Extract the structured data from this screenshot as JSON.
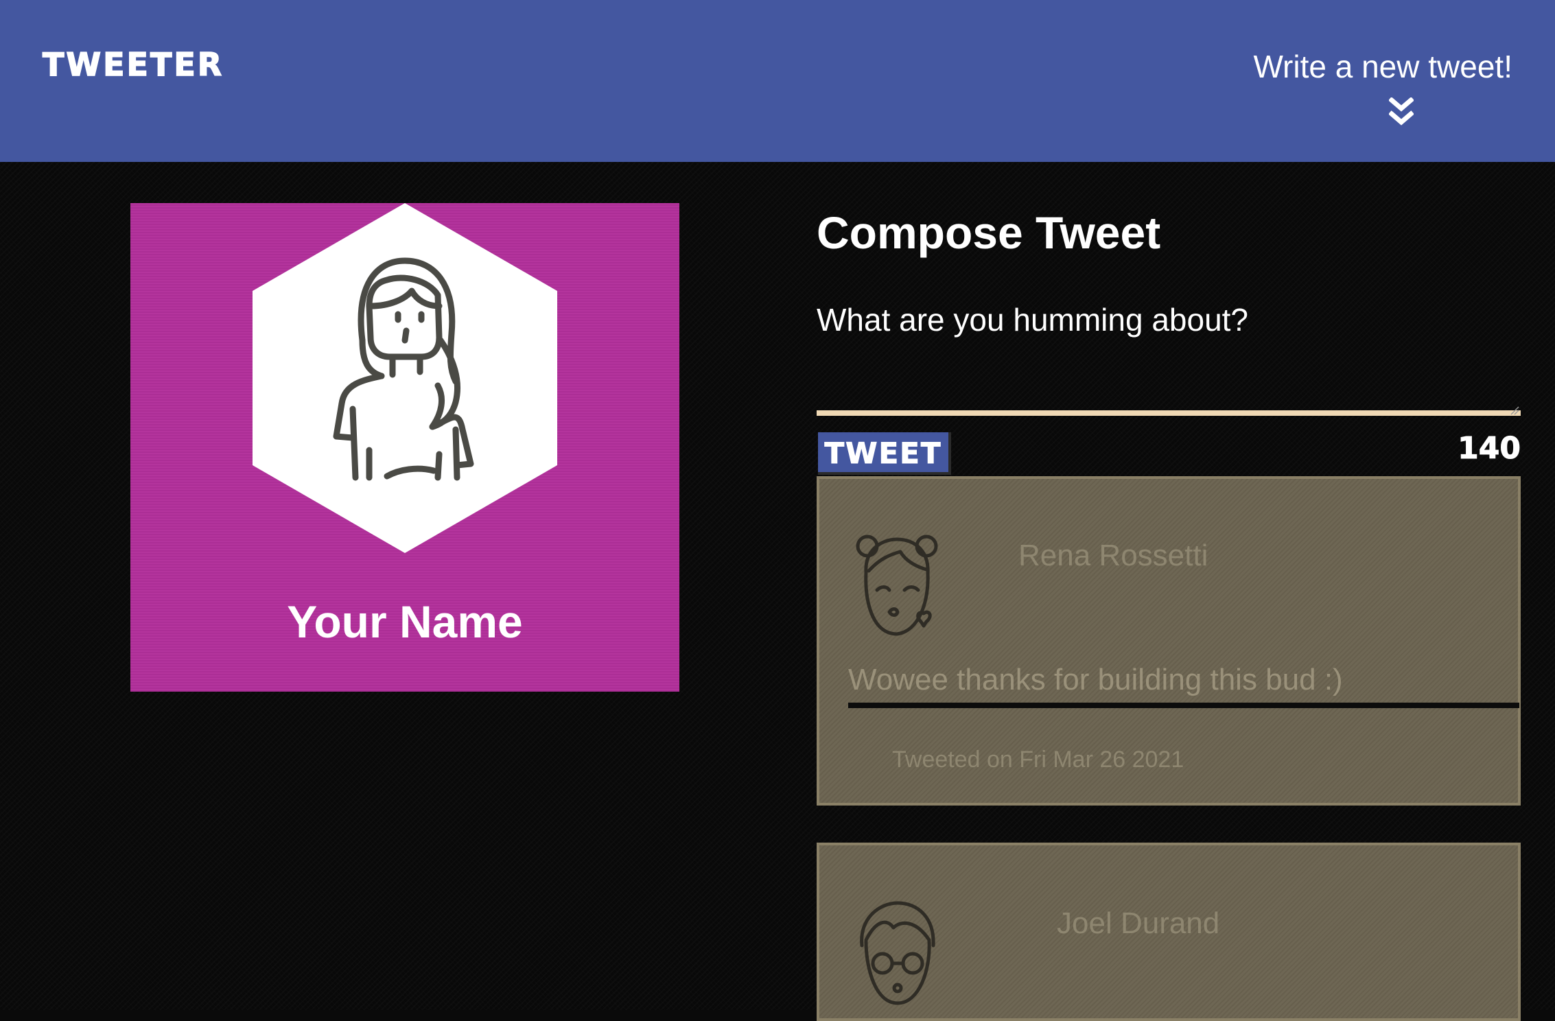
{
  "navbar": {
    "brand": "TWEETER",
    "new_tweet_label": "Write a new tweet!"
  },
  "profile": {
    "name": "Your Name"
  },
  "compose": {
    "title": "Compose Tweet",
    "placeholder": "What are you humming about?",
    "button_label": "TWEET",
    "counter": "140"
  },
  "tweets": [
    {
      "author": "Rena Rossetti",
      "content": "Wowee thanks for building this bud :)",
      "date": "Tweeted on Fri Mar 26 2021"
    },
    {
      "author": "Joel Durand"
    }
  ],
  "colors": {
    "navbar": "#4457a0",
    "profile_card": "#b2309b",
    "tweet_card": "#6b6350",
    "compose_underline": "#f0d9b5"
  }
}
